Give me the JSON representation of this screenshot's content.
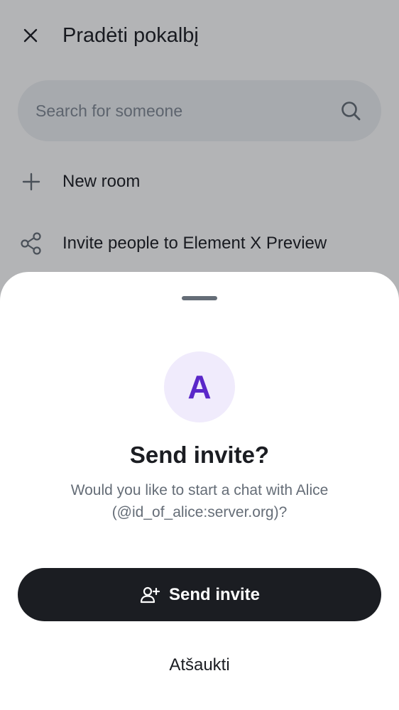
{
  "screen": {
    "title": "Pradėti pokalbį",
    "close_icon": "close-icon",
    "search": {
      "placeholder": "Search for someone",
      "icon": "search-icon"
    },
    "actions": [
      {
        "label": "New room",
        "icon": "plus-icon"
      },
      {
        "label": "Invite people to Element X Preview",
        "icon": "share-icon"
      }
    ]
  },
  "sheet": {
    "avatar_letter": "A",
    "title": "Send invite?",
    "message": "Would you like to start a chat with Alice (@id_of_alice:server.org)?",
    "send_button": {
      "label": "Send invite",
      "icon": "person-add-icon"
    },
    "cancel_button": {
      "label": "Atšaukti"
    }
  },
  "colors": {
    "primary_text": "#1b1d22",
    "secondary_text": "#656d77",
    "avatar_bg": "#f0ebfc",
    "avatar_fg": "#5a27c9",
    "button_bg": "#1b1d22",
    "search_bg": "#eef0f3"
  }
}
